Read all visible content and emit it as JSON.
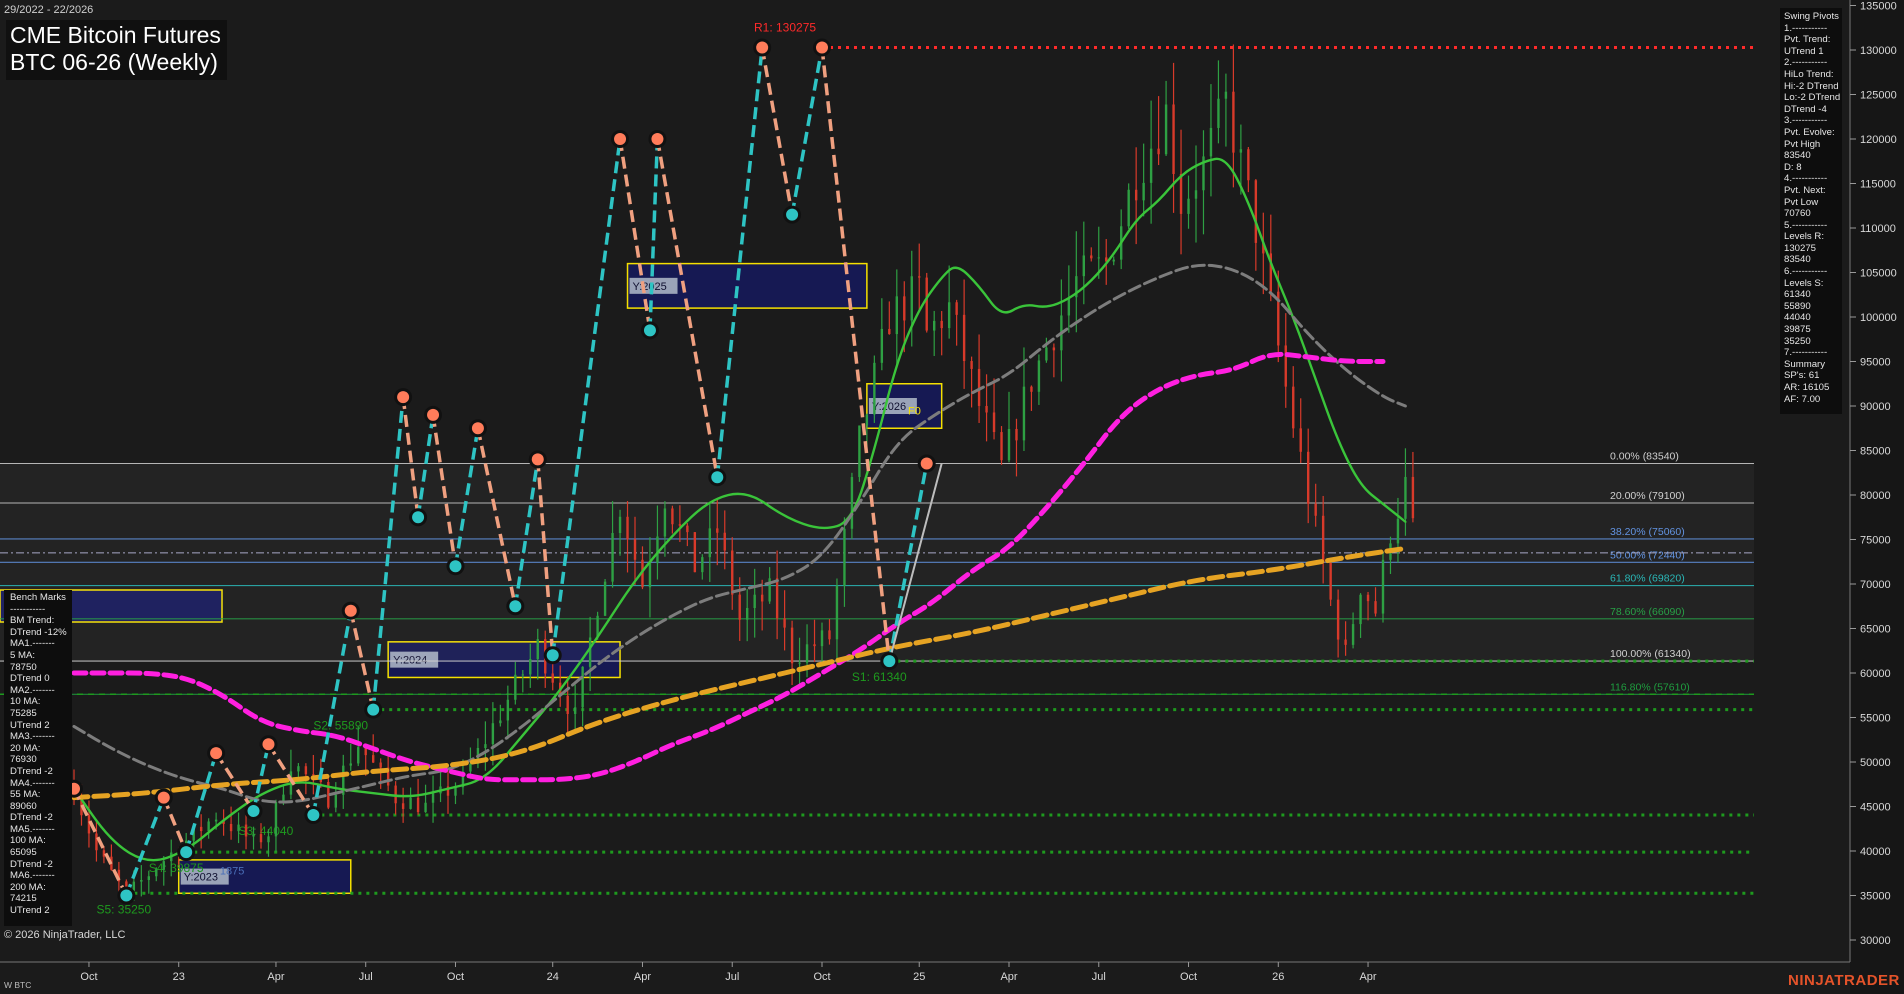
{
  "header": {
    "title_line1": "CME Bitcoin Futures",
    "title_line2": "BTC 06-26 (Weekly)",
    "date_range": "29/2022 - 22/2026"
  },
  "footer": {
    "copyright": "© 2026 NinjaTrader, LLC",
    "instrument": "W BTC",
    "brand": "NINJATRADER"
  },
  "colors": {
    "background": "#1b1b1b",
    "up_candle": "#2ea043",
    "down_candle": "#d83a2a",
    "ma_green": "#3ac43a",
    "ma_grey": "#7d7d7d",
    "ma_magenta": "#ff1fe0",
    "ma_orange": "#e6a323",
    "pivot_up_line": "#2ec4c4",
    "pivot_down_line": "#f0a080",
    "resistance": "#ff2a2a",
    "support": "#1e9a1e",
    "yearly_box_fill": "#16195a",
    "yearly_box_border": "#f5e000"
  },
  "swing_panel": {
    "lines": [
      "Swing Pivots",
      "1.-----------",
      "Pvt. Trend:",
      "UTrend 1",
      "2.-----------",
      "HiLo Trend:",
      "Hi:-2 DTrend",
      "Lo:-2 DTrend",
      "DTrend -4",
      "3.-----------",
      "Pvt. Evolve:",
      "Pvt High",
      "83540",
      "D: 8",
      "4.-----------",
      "Pvt. Next:",
      "Pvt Low",
      "70760",
      "5.-----------",
      "Levels R:",
      "130275",
      "83540",
      "6.-----------",
      "Levels S:",
      "61340",
      "55890",
      "44040",
      "39875",
      "35250",
      "7.-----------",
      "Summary",
      "SP's: 61",
      "AR: 16105",
      "AF: 7.00"
    ]
  },
  "bench_panel": {
    "lines": [
      "Bench Marks",
      "-----------",
      "BM Trend:",
      "DTrend -12%",
      "MA1.-------",
      "5 MA:",
      "78750",
      "DTrend 0",
      "MA2.-------",
      "10 MA:",
      "75285",
      "UTrend 2",
      "MA3.-------",
      "20 MA:",
      "76930",
      "DTrend -2",
      "MA4.-------",
      "55 MA:",
      "89060",
      "DTrend -2",
      "MA5.-------",
      "100 MA:",
      "65095",
      "DTrend -2",
      "MA6.-------",
      "200 MA:",
      "74215",
      "UTrend 2"
    ]
  },
  "chart_data": {
    "type": "candlestick",
    "ylim": [
      28000,
      135000
    ],
    "yticks": [
      30000,
      35000,
      40000,
      45000,
      50000,
      55000,
      60000,
      65000,
      70000,
      75000,
      80000,
      85000,
      90000,
      95000,
      100000,
      105000,
      110000,
      115000,
      120000,
      125000,
      130000,
      135000
    ],
    "xticks": [
      {
        "label": "Oct",
        "week": 2
      },
      {
        "label": "23",
        "week": 14
      },
      {
        "label": "Apr",
        "week": 27
      },
      {
        "label": "Jul",
        "week": 39
      },
      {
        "label": "Oct",
        "week": 51
      },
      {
        "label": "24",
        "week": 64
      },
      {
        "label": "Apr",
        "week": 76
      },
      {
        "label": "Jul",
        "week": 88
      },
      {
        "label": "Oct",
        "week": 100
      },
      {
        "label": "25",
        "week": 113
      },
      {
        "label": "Apr",
        "week": 125
      },
      {
        "label": "Jul",
        "week": 137
      },
      {
        "label": "Oct",
        "week": 149
      },
      {
        "label": "26",
        "week": 161
      },
      {
        "label": "Apr",
        "week": 173
      }
    ],
    "price_anchors": [
      [
        0,
        47000
      ],
      [
        3,
        40000
      ],
      [
        7,
        35000
      ],
      [
        12,
        39000
      ],
      [
        19,
        44000
      ],
      [
        24,
        41000
      ],
      [
        26,
        42000
      ],
      [
        29,
        50000
      ],
      [
        34,
        46000
      ],
      [
        38,
        52000
      ],
      [
        43,
        46000
      ],
      [
        47,
        45000
      ],
      [
        52,
        48000
      ],
      [
        58,
        57000
      ],
      [
        62,
        63000
      ],
      [
        67,
        55000
      ],
      [
        70,
        68000
      ],
      [
        73,
        79000
      ],
      [
        76,
        70000
      ],
      [
        79,
        80000
      ],
      [
        83,
        72000
      ],
      [
        86,
        76000
      ],
      [
        89,
        66000
      ],
      [
        93,
        69000
      ],
      [
        96,
        62000
      ],
      [
        101,
        64000
      ],
      [
        105,
        86000
      ],
      [
        109,
        100000
      ],
      [
        113,
        103000
      ],
      [
        114,
        98000
      ],
      [
        117,
        101000
      ],
      [
        121,
        90000
      ],
      [
        124,
        83000
      ],
      [
        128,
        93000
      ],
      [
        134,
        104000
      ],
      [
        138,
        106000
      ],
      [
        142,
        116000
      ],
      [
        146,
        123000
      ],
      [
        148,
        113000
      ],
      [
        151,
        117000
      ],
      [
        154,
        124000
      ],
      [
        158,
        110000
      ],
      [
        162,
        92000
      ],
      [
        165,
        80000
      ],
      [
        168,
        68000
      ],
      [
        170,
        62000
      ],
      [
        172,
        70000
      ],
      [
        174,
        67000
      ],
      [
        176,
        76000
      ],
      [
        178,
        81000
      ],
      [
        179,
        76000
      ]
    ],
    "ma_series": [
      {
        "key": "green",
        "points": [
          [
            0,
            47000
          ],
          [
            5,
            41000
          ],
          [
            10,
            38500
          ],
          [
            15,
            40000
          ],
          [
            20,
            43500
          ],
          [
            25,
            46500
          ],
          [
            30,
            48000
          ],
          [
            35,
            47000
          ],
          [
            40,
            46500
          ],
          [
            45,
            46000
          ],
          [
            50,
            47000
          ],
          [
            55,
            48000
          ],
          [
            60,
            53000
          ],
          [
            65,
            58000
          ],
          [
            70,
            64000
          ],
          [
            75,
            70500
          ],
          [
            80,
            75500
          ],
          [
            85,
            79500
          ],
          [
            90,
            80500
          ],
          [
            95,
            77500
          ],
          [
            100,
            76000
          ],
          [
            104,
            77000
          ],
          [
            107,
            85000
          ],
          [
            110,
            95000
          ],
          [
            113,
            101000
          ],
          [
            116,
            104500
          ],
          [
            118,
            106000
          ],
          [
            121,
            103500
          ],
          [
            124,
            100000
          ],
          [
            127,
            101500
          ],
          [
            130,
            101000
          ],
          [
            133,
            102000
          ],
          [
            136,
            104000
          ],
          [
            139,
            107000
          ],
          [
            142,
            111000
          ],
          [
            145,
            113000
          ],
          [
            148,
            116000
          ],
          [
            151,
            117500
          ],
          [
            154,
            118000
          ],
          [
            157,
            113000
          ],
          [
            160,
            106000
          ],
          [
            163,
            100000
          ],
          [
            166,
            93000
          ],
          [
            169,
            86000
          ],
          [
            172,
            81000
          ],
          [
            175,
            79000
          ],
          [
            178,
            77000
          ]
        ]
      },
      {
        "key": "grey",
        "points": [
          [
            0,
            54000
          ],
          [
            5,
            51500
          ],
          [
            10,
            49500
          ],
          [
            15,
            48000
          ],
          [
            20,
            47000
          ],
          [
            25,
            45500
          ],
          [
            30,
            45500
          ],
          [
            35,
            46500
          ],
          [
            40,
            47500
          ],
          [
            45,
            48500
          ],
          [
            50,
            49000
          ],
          [
            55,
            51000
          ],
          [
            60,
            54000
          ],
          [
            65,
            57500
          ],
          [
            70,
            61000
          ],
          [
            75,
            64000
          ],
          [
            80,
            66500
          ],
          [
            85,
            68500
          ],
          [
            90,
            69500
          ],
          [
            95,
            70500
          ],
          [
            100,
            73000
          ],
          [
            105,
            79000
          ],
          [
            110,
            86000
          ],
          [
            115,
            89000
          ],
          [
            120,
            91500
          ],
          [
            125,
            93500
          ],
          [
            130,
            97000
          ],
          [
            135,
            100000
          ],
          [
            140,
            102500
          ],
          [
            145,
            104500
          ],
          [
            150,
            106000
          ],
          [
            155,
            105500
          ],
          [
            160,
            103000
          ],
          [
            165,
            98000
          ],
          [
            170,
            94000
          ],
          [
            175,
            91000
          ],
          [
            178,
            90000
          ]
        ]
      },
      {
        "key": "magenta",
        "points": [
          [
            0,
            60000
          ],
          [
            5,
            60000
          ],
          [
            10,
            60000
          ],
          [
            15,
            59500
          ],
          [
            20,
            57500
          ],
          [
            25,
            54500
          ],
          [
            30,
            53500
          ],
          [
            35,
            53000
          ],
          [
            40,
            51500
          ],
          [
            45,
            50000
          ],
          [
            50,
            49000
          ],
          [
            55,
            48000
          ],
          [
            60,
            48000
          ],
          [
            65,
            48000
          ],
          [
            70,
            48500
          ],
          [
            75,
            50000
          ],
          [
            80,
            52000
          ],
          [
            85,
            53500
          ],
          [
            90,
            55500
          ],
          [
            95,
            57500
          ],
          [
            100,
            60000
          ],
          [
            105,
            62500
          ],
          [
            110,
            65500
          ],
          [
            115,
            68000
          ],
          [
            120,
            71500
          ],
          [
            125,
            74000
          ],
          [
            130,
            78500
          ],
          [
            135,
            83500
          ],
          [
            140,
            89000
          ],
          [
            145,
            92000
          ],
          [
            150,
            93500
          ],
          [
            155,
            94000
          ],
          [
            160,
            96000
          ],
          [
            165,
            95500
          ],
          [
            170,
            95000
          ],
          [
            175,
            95000
          ]
        ]
      },
      {
        "key": "orange",
        "points": [
          [
            0,
            46000
          ],
          [
            10,
            46500
          ],
          [
            20,
            47500
          ],
          [
            30,
            48000
          ],
          [
            40,
            49000
          ],
          [
            50,
            49500
          ],
          [
            60,
            51000
          ],
          [
            70,
            54500
          ],
          [
            80,
            57000
          ],
          [
            90,
            59000
          ],
          [
            100,
            61000
          ],
          [
            110,
            63000
          ],
          [
            120,
            64500
          ],
          [
            130,
            66500
          ],
          [
            140,
            68500
          ],
          [
            150,
            70500
          ],
          [
            160,
            71500
          ],
          [
            170,
            73000
          ],
          [
            178,
            74000
          ]
        ]
      }
    ],
    "swing_pivots": [
      [
        0,
        47000
      ],
      [
        7,
        35000
      ],
      [
        12,
        46000
      ],
      [
        15,
        39875
      ],
      [
        19,
        51000
      ],
      [
        24,
        44500
      ],
      [
        26,
        52000
      ],
      [
        32,
        44040
      ],
      [
        37,
        67000
      ],
      [
        40,
        55890
      ],
      [
        44,
        91000
      ],
      [
        46,
        77500
      ],
      [
        48,
        89000
      ],
      [
        51,
        72000
      ],
      [
        54,
        87500
      ],
      [
        59,
        67500
      ],
      [
        62,
        84000
      ],
      [
        64,
        62000
      ],
      [
        73,
        120000
      ],
      [
        77,
        98500
      ],
      [
        78,
        120000
      ],
      [
        86,
        82000
      ],
      [
        92,
        130275
      ],
      [
        96,
        111500
      ],
      [
        100,
        130275
      ],
      [
        109,
        61340
      ],
      [
        114,
        83540
      ]
    ],
    "resistance_levels": [
      {
        "label": "R1: 130275",
        "value": 130275,
        "from_week": 100
      }
    ],
    "support_levels": [
      {
        "label": "S1: 61340",
        "value": 61340,
        "from_week": 109,
        "label_week": 104
      },
      {
        "label": "S2: 55890",
        "value": 55890,
        "from_week": 40,
        "label_week": 32
      },
      {
        "label": "S3: 44040",
        "value": 44040,
        "from_week": 32,
        "label_week": 22
      },
      {
        "label": "S4: 39875",
        "value": 39875,
        "from_week": 15,
        "label_week": 10
      },
      {
        "label": "S5: 35250",
        "value": 35250,
        "from_week": 7,
        "label_week": 3
      }
    ],
    "extra_support_lines": [
      57610
    ],
    "fib_levels": [
      {
        "label": "0.00% (83540)",
        "value": 83540
      },
      {
        "label": "20.00% (79100)",
        "value": 79100
      },
      {
        "label": "38.20% (75060)",
        "value": 75060
      },
      {
        "label": "50.00% (72440)",
        "value": 72440
      },
      {
        "label": "61.80% (69820)",
        "value": 69820
      },
      {
        "label": "78.60% (66090)",
        "value": 66090
      },
      {
        "label": "100.00% (61340)",
        "value": 61340
      },
      {
        "label": "116.80% (57610)",
        "value": 57610
      }
    ],
    "yearly_boxes": [
      {
        "label": "Y:2023",
        "from_week": 14,
        "to_week": 37,
        "low": 35250,
        "high": 39000
      },
      {
        "label": "Y:2024",
        "from_week": 42,
        "to_week": 73,
        "low": 59500,
        "high": 63500
      },
      {
        "label": "Y:2025",
        "from_week": 74,
        "to_week": 106,
        "low": 101000,
        "high": 106000
      },
      {
        "label": "Y:2026",
        "from_week": 106,
        "to_week": 116,
        "low": 87500,
        "high": 92500
      }
    ],
    "box_annotations": [
      {
        "label": "F0",
        "value": 89500
      },
      {
        "label": "1875",
        "value": 37800
      }
    ],
    "price_markers": [
      {
        "value": 73500
      }
    ]
  }
}
